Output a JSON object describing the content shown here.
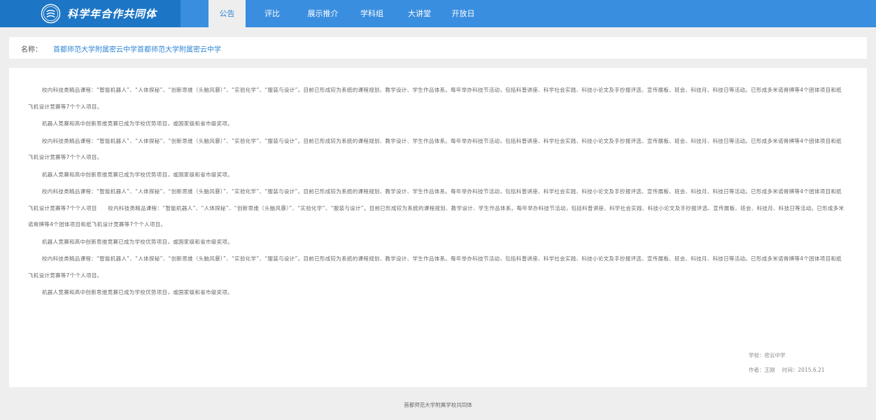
{
  "header": {
    "logo_title": "科学年合作共同体",
    "logo_icon": "school-emblem-icon",
    "nav": [
      {
        "label": "公告",
        "active": true
      },
      {
        "label": "评比",
        "active": false
      },
      {
        "label": "展示推介",
        "active": false
      },
      {
        "label": "学科组",
        "active": false
      },
      {
        "label": "大讲堂",
        "active": false
      },
      {
        "label": "开放日",
        "active": false
      }
    ]
  },
  "name_bar": {
    "label": "名称：",
    "value": "首都师范大学附属密云中学首都师范大学附属密云中学"
  },
  "article": {
    "paragraphs": [
      "校内科技类精品课程：“智能机器人”、“人体探秘”、“创新思维（头脑风暴）”、“实验化学”、“服装与设计”。目前已形成较为系统的课程规划、教学设计、学生作品体系。每年举办科技节活动，包括科普讲座、科学社会实践、科技小论文及手抄报评选、宣传展板、班会、科技月、科技日等活动。已形成多米诺骨牌等4个团体项目和纸飞机设计竞赛等7个个人项目。",
      "机器人竞赛和高中创新思维竞赛已成为学校优势项目，或国家级和省市级奖项。",
      "校内科技类精品课程：“智能机器人”、“人体探秘”、“创新思维（头脑风暴）”、“实验化学”、“服装与设计”。目前已形成较为系统的课程规划、教学设计、学生作品体系。每年举办科技节活动，包括科普讲座、科学社会实践、科技小论文及手抄报评选、宣传展板、班会、科技月、科技日等活动。已形成多米诺骨牌等4个团体项目和纸飞机设计竞赛等7个个人项目。",
      "机器人竞赛和高中创新思维竞赛已成为学校优势项目，或国家级和省市级奖项。",
      "校内科技类精品课程：“智能机器人”、“人体探秘”、“创新思维（头脑风暴）”、“实验化学”、“服装与设计”。目前已形成较为系统的课程规划、教学设计、学生作品体系。每年举办科技节活动，包括科普讲座、科学社会实践、科技小论文及手抄报评选、宣传展板、班会、科技月、科技日等活动。已形成多米诺骨牌等4个团体项目和纸飞机设计竞赛等7个个人项目　　校内科技类精品课程：“智能机器人”、“人体探秘”、“创新思维（头脑风暴）”、“实验化学”、“服装与设计”。目前已形成较为系统的课程规划、教学设计、学生作品体系。每年举办科技节活动，包括科普讲座、科学社会实践、科技小论文及手抄报评选、宣传展板、班会、科技月、科技日等活动。已形成多米诺骨牌等4个团体项目和纸飞机设计竞赛等7个个人项目。",
      "机器人竞赛和高中创新思维竞赛已成为学校优势项目，或国家级和省市级奖项。",
      "校内科技类精品课程：“智能机器人”、“人体探秘”、“创新思维（头脑风暴）”、“实验化学”、“服装与设计”。目前已形成较为系统的课程规划、教学设计、学生作品体系。每年举办科技节活动，包括科普讲座、科学社会实践、科技小论文及手抄报评选、宣传展板、班会、科技月、科技日等活动。已形成多米诺骨牌等4个团体项目和纸飞机设计竞赛等7个个人项目。",
      "机器人竞赛和高中创新思维竞赛已成为学校优势项目，或国家级和省市级奖项。"
    ]
  },
  "meta": {
    "school": "学校：密云中学",
    "author": "作者：王刚",
    "time": "时间：2015.6.21"
  },
  "footer": {
    "text": "首都师范大学附属学校共同体"
  },
  "colors": {
    "header_bg": "#3a8ee0",
    "logo_bg": "#1d76c5",
    "accent": "#2f85d6",
    "page_bg": "#eeeeee"
  }
}
